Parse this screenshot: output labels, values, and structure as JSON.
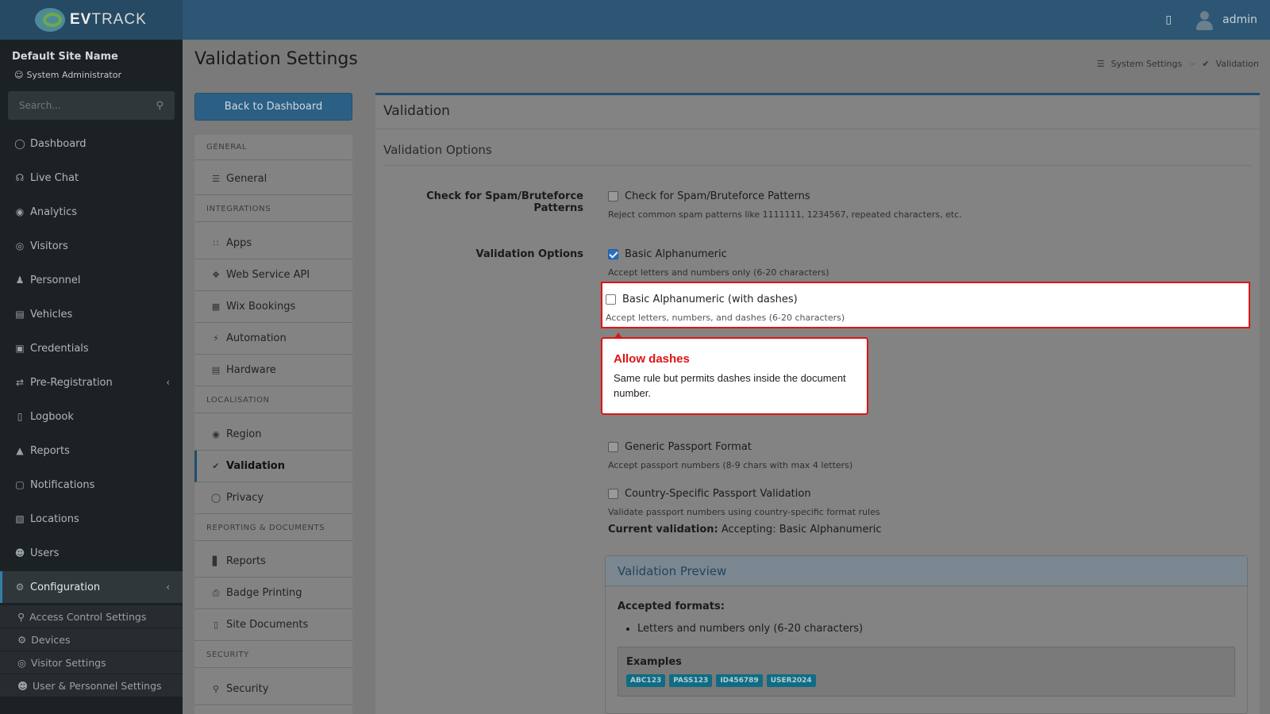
{
  "app": {
    "brand_prefix": "EV",
    "brand_suffix": "TRACK",
    "user_name": "admin"
  },
  "sidebar": {
    "site_name": "Default Site Name",
    "role": "System Administrator",
    "search_placeholder": "Search...",
    "items": [
      {
        "label": "Dashboard",
        "icon": "dashboard-icon"
      },
      {
        "label": "Live Chat",
        "icon": "headset-icon"
      },
      {
        "label": "Analytics",
        "icon": "analytics-icon"
      },
      {
        "label": "Visitors",
        "icon": "eye-icon"
      },
      {
        "label": "Personnel",
        "icon": "personnel-icon"
      },
      {
        "label": "Vehicles",
        "icon": "vehicle-icon"
      },
      {
        "label": "Credentials",
        "icon": "credentials-icon"
      },
      {
        "label": "Pre-Registration",
        "icon": "arrows-icon"
      },
      {
        "label": "Logbook",
        "icon": "book-icon"
      },
      {
        "label": "Reports",
        "icon": "reports-icon"
      },
      {
        "label": "Notifications",
        "icon": "notifications-icon"
      },
      {
        "label": "Locations",
        "icon": "map-icon"
      },
      {
        "label": "Users",
        "icon": "users-icon"
      },
      {
        "label": "Configuration",
        "icon": "gear-icon"
      }
    ],
    "sub_items": [
      {
        "label": "Access Control Settings",
        "icon": "lock-icon"
      },
      {
        "label": "Devices",
        "icon": "device-icon"
      },
      {
        "label": "Visitor Settings",
        "icon": "eye-icon"
      },
      {
        "label": "User & Personnel Settings",
        "icon": "users-icon"
      }
    ]
  },
  "page": {
    "title": "Validation Settings",
    "breadcrumb": [
      "System Settings",
      "Validation"
    ],
    "back_button": "Back to Dashboard"
  },
  "settings_nav": {
    "sections": [
      "GENERAL",
      "INTEGRATIONS",
      "LOCALISATION",
      "REPORTING & DOCUMENTS",
      "SECURITY"
    ],
    "items": [
      "General",
      "Apps",
      "Web Service API",
      "Wix Bookings",
      "Automation",
      "Hardware",
      "Region",
      "Validation",
      "Privacy",
      "Reports",
      "Badge Printing",
      "Site Documents",
      "Security"
    ]
  },
  "panel": {
    "title": "Validation",
    "subtitle": "Validation Options",
    "spam_label": "Check for Spam/Bruteforce Patterns",
    "spam_option": "Check for Spam/Bruteforce Patterns",
    "spam_help": "Reject common spam patterns like 1111111, 1234567, repeated characters, etc.",
    "options_label": "Validation Options",
    "options": [
      {
        "label": "Basic Alphanumeric",
        "help": "Accept letters and numbers only (6-20 characters)",
        "checked": true
      },
      {
        "label": "Basic Alphanumeric (with dashes)",
        "help": "Accept letters, numbers, and dashes (6-20 characters)",
        "checked": false
      },
      {
        "label": "Generic Passport Format",
        "help": "Accept passport numbers (8-9 chars with max 4 letters)",
        "checked": false
      },
      {
        "label": "Country-Specific Passport Validation",
        "help": "Validate passport numbers using country-specific format rules",
        "checked": false
      }
    ],
    "current_label": "Current validation:",
    "current_value": "Accepting: Basic Alphanumeric"
  },
  "preview": {
    "title": "Validation Preview",
    "accepted_label": "Accepted formats:",
    "accepted": [
      "Letters and numbers only (6-20 characters)"
    ],
    "examples_title": "Examples",
    "examples": [
      "ABC123",
      "PASS123",
      "ID456789",
      "USER2024"
    ]
  },
  "tooltip": {
    "title": "Allow dashes",
    "body": "Same rule but permits dashes inside the document number."
  },
  "colors": {
    "accent": "#2c5673",
    "callout": "#e01414",
    "badge": "#0f6c84"
  }
}
